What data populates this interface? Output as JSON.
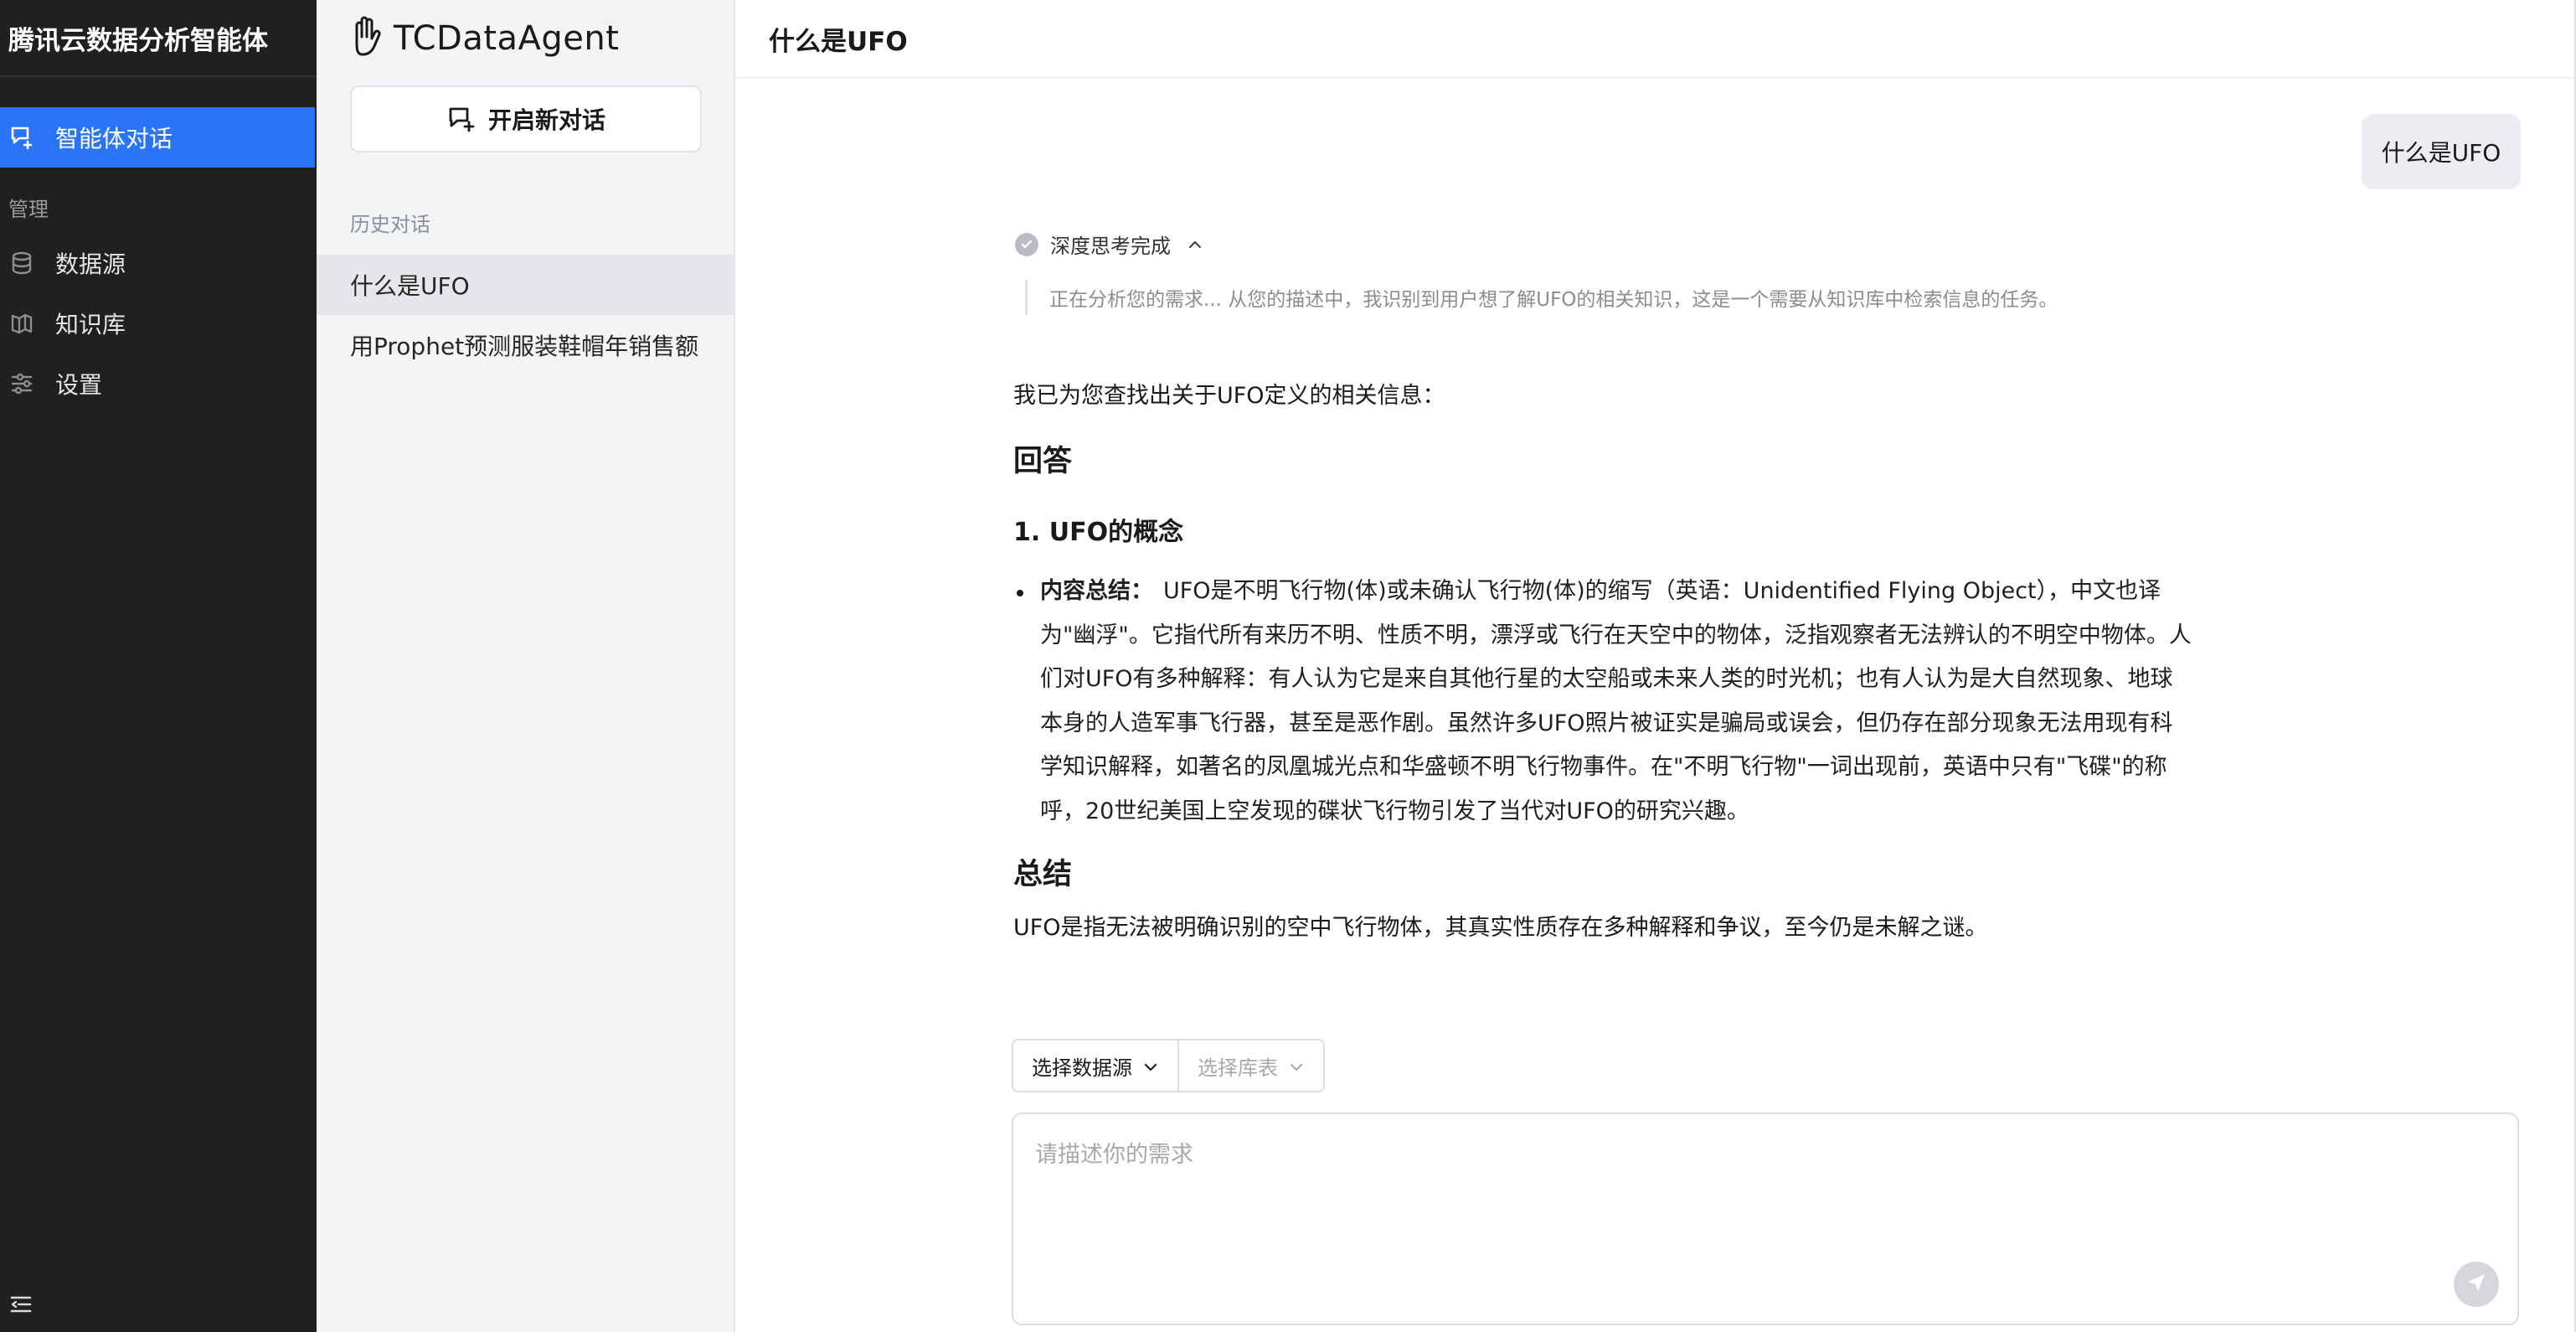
{
  "sidebar": {
    "brand": "腾讯云数据分析智能体",
    "chat_item": "智能体对话",
    "section_label": "管理",
    "items": [
      {
        "label": "数据源",
        "icon": "database-icon"
      },
      {
        "label": "知识库",
        "icon": "book-icon"
      },
      {
        "label": "设置",
        "icon": "sliders-icon"
      }
    ],
    "accent_color": "#2a74f7"
  },
  "history": {
    "logo_text": "TCDataAgent",
    "new_chat_label": "开启新对话",
    "section_label": "历史对话",
    "items": [
      "什么是UFO",
      "用Prophet预测服装鞋帽年销售额"
    ]
  },
  "main": {
    "title": "什么是UFO",
    "user_message": "什么是UFO",
    "thinking": {
      "status": "深度思考完成",
      "content": "正在分析您的需求... 从您的描述中，我识别到用户想了解UFO的相关知识，这是一个需要从知识库中检索信息的任务。"
    },
    "answer": {
      "intro": "我已为您查找出关于UFO定义的相关信息：",
      "heading": "回答",
      "subheading": "1. UFO的概念",
      "bullet_label": "内容总结：",
      "bullet_text": "UFO是不明飞行物(体)或未确认飞行物(体)的缩写（英语：Unidentified Flying Object），中文也译为\"幽浮\"。它指代所有来历不明、性质不明，漂浮或飞行在天空中的物体，泛指观察者无法辨认的不明空中物体。人们对UFO有多种解释：有人认为它是来自其他行星的太空船或未来人类的时光机；也有人认为是大自然现象、地球本身的人造军事飞行器，甚至是恶作剧。虽然许多UFO照片被证实是骗局或误会，但仍存在部分现象无法用现有科学知识解释，如著名的凤凰城光点和华盛顿不明飞行物事件。在\"不明飞行物\"一词出现前，英语中只有\"飞碟\"的称呼，20世纪美国上空发现的碟状飞行物引发了当代对UFO的研究兴趣。",
      "summary_heading": "总结",
      "summary": "UFO是指无法被明确识别的空中飞行物体，其真实性质存在多种解释和争议，至今仍是未解之谜。"
    },
    "selectors": {
      "datasource": "选择数据源",
      "table": "选择库表"
    },
    "input": {
      "placeholder": "请描述你的需求",
      "value": ""
    }
  }
}
